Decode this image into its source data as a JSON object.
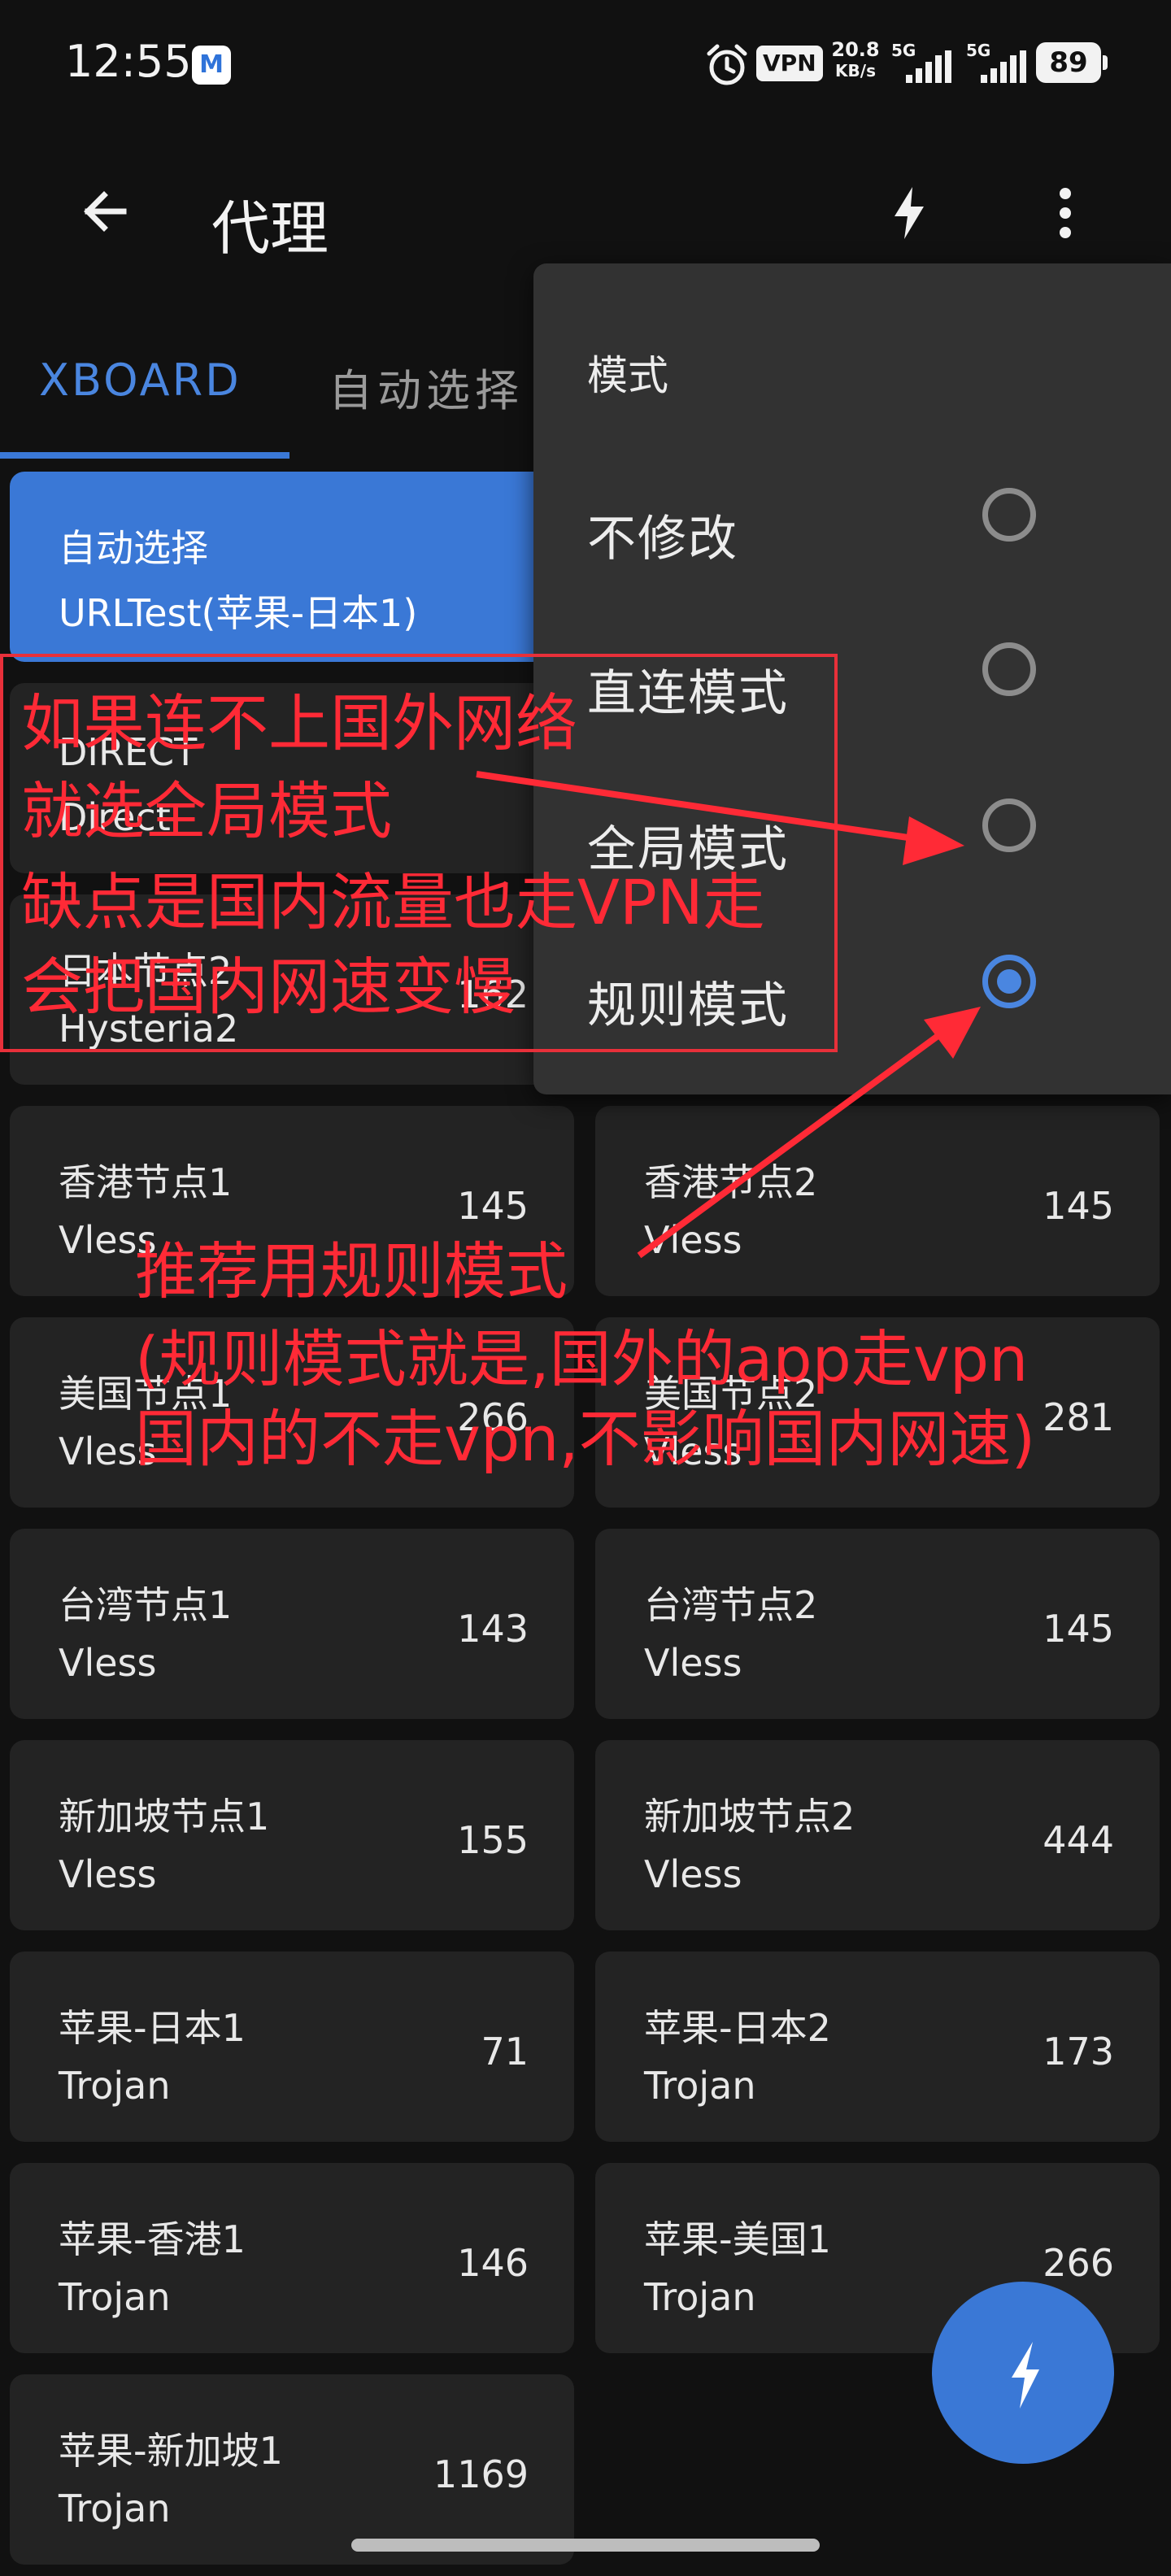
{
  "status_bar": {
    "time": "12:55",
    "msg_icon": "M",
    "vpn": "VPN",
    "speed_value": "20.8",
    "speed_unit": "KB/s",
    "signal1": "5G",
    "signal2": "5G",
    "battery": "89"
  },
  "app_bar": {
    "title": "代理",
    "back_icon": "arrow-left-icon",
    "bolt_icon": "lightning-icon",
    "more_icon": "more-vert-icon"
  },
  "tabs": [
    {
      "label": "XBOARD",
      "selected": true
    },
    {
      "label": "自动选择",
      "selected": false
    }
  ],
  "proxies": [
    {
      "name": "自动选择",
      "type": "URLTest(苹果-日本1)",
      "delay": "",
      "selected": true
    },
    {
      "name": "DIRECT",
      "type": "Direct",
      "delay": ""
    },
    {
      "name": "日本节点2",
      "type": "Hysteria2",
      "delay": "162"
    },
    {
      "name": "香港节点1",
      "type": "Vless",
      "delay": "145"
    },
    {
      "name": "香港节点2",
      "type": "Vless",
      "delay": "145"
    },
    {
      "name": "美国节点1",
      "type": "Vless",
      "delay": "266"
    },
    {
      "name": "美国节点2",
      "type": "Vless",
      "delay": "281"
    },
    {
      "name": "台湾节点1",
      "type": "Vless",
      "delay": "143"
    },
    {
      "name": "台湾节点2",
      "type": "Vless",
      "delay": "145"
    },
    {
      "name": "新加坡节点1",
      "type": "Vless",
      "delay": "155"
    },
    {
      "name": "新加坡节点2",
      "type": "Vless",
      "delay": "444"
    },
    {
      "name": "苹果-日本1",
      "type": "Trojan",
      "delay": "71"
    },
    {
      "name": "苹果-日本2",
      "type": "Trojan",
      "delay": "173"
    },
    {
      "name": "苹果-香港1",
      "type": "Trojan",
      "delay": "146"
    },
    {
      "name": "苹果-美国1",
      "type": "Trojan",
      "delay": "266"
    },
    {
      "name": "苹果-新加坡1",
      "type": "Trojan",
      "delay": "1169"
    }
  ],
  "mode_menu": {
    "header": "模式",
    "options": [
      {
        "label": "不修改",
        "checked": false
      },
      {
        "label": "直连模式",
        "checked": false
      },
      {
        "label": "全局模式",
        "checked": false
      },
      {
        "label": "规则模式",
        "checked": true
      }
    ]
  },
  "annotations": {
    "box_lines": [
      "如果连不上国外网络",
      "就选全局模式",
      "缺点是国内流量也走VPN走",
      "会把国内网速变慢"
    ],
    "recommend_lines": [
      "推荐用规则模式",
      "(规则模式就是,国外的app走vpn",
      "国内的不走vpn,不影响国内网速)"
    ],
    "color": "#ff2a36"
  },
  "fab": {
    "icon": "lightning-icon"
  },
  "colors": {
    "accent": "#3a78d6",
    "background": "#111111",
    "card": "#232323",
    "menu": "#323232"
  }
}
